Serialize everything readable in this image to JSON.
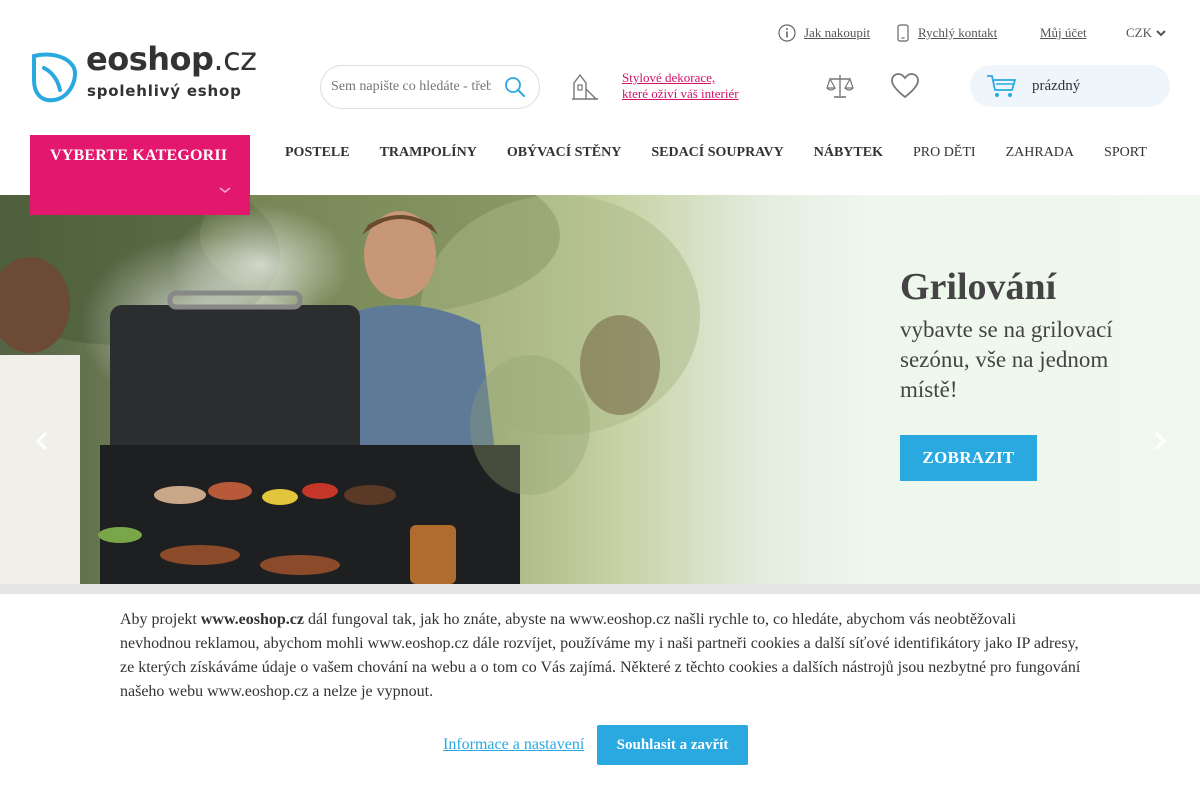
{
  "colors": {
    "accent_pink": "#e4176f",
    "accent_blue": "#2aa9e0",
    "promo_pink": "#d1126b"
  },
  "topbar": {
    "how_to_buy": "Jak nakoupit",
    "quick_contact": "Rychlý kontakt",
    "account": "Můj účet",
    "currency": "CZK"
  },
  "logo": {
    "brand": "eoshop",
    "tld": ".cz",
    "tagline": "spolehlivý eshop"
  },
  "search": {
    "placeholder": "Sem napište co hledáte - třeba postel"
  },
  "promo": {
    "line1": "Stylové dekorace,",
    "line2": "které oživí váš interiér"
  },
  "cart": {
    "status": "prázdný"
  },
  "nav": {
    "category_button": "VYBERTE KATEGORII",
    "items": [
      "POSTELE",
      "TRAMPOLÍNY",
      "OBÝVACÍ STĚNY",
      "SEDACÍ SOUPRAVY",
      "NÁBYTEK",
      "PRO DĚTI",
      "ZAHRADA",
      "SPORT"
    ]
  },
  "hero": {
    "title": "Grilování",
    "subtitle": "vybavte se na grilovací sezónu, vše na jednom místě!",
    "button": "ZOBRAZIT"
  },
  "cookie": {
    "text_before": "Aby projekt ",
    "site_bold": "www.eoshop.cz",
    "text_after": " dál fungoval tak, jak ho znáte, abyste na www.eoshop.cz našli rychle to, co hledáte, abychom vás neobtěžovali nevhodnou reklamou, abychom mohli www.eoshop.cz dále rozvíjet, používáme my i naši partneři cookies a další síťové identifikátory jako IP adresy, ze kterých získáváme údaje o vašem chování na webu a o tom co Vás zajímá. Některé z těchto cookies a dalších nástrojů jsou nezbytné pro fungování našeho webu www.eoshop.cz a nelze je vypnout.",
    "info_link": "Informace a nastavení",
    "accept_button": "Souhlasit a zavřít"
  }
}
